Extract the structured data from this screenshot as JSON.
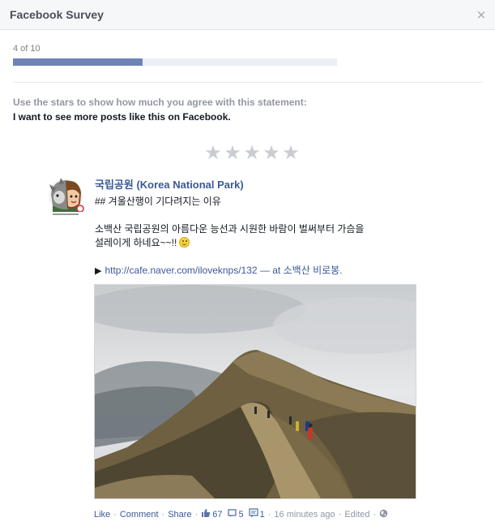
{
  "dialog": {
    "title": "Facebook Survey",
    "close_glyph": "×"
  },
  "progress": {
    "text": "4 of 10",
    "current": 4,
    "total": 10,
    "fraction": 0.4,
    "fill_color": "#6d84b4"
  },
  "question": {
    "instruction": "Use the stars to show how much you agree with this statement:",
    "statement": "I want to see more posts like this on Facebook.",
    "stars_total": 5,
    "stars_selected": 0,
    "star_glyph": "★"
  },
  "post": {
    "page_name": "국립공원 (Korea National Park)",
    "line1": "## 겨울산행이 기다려지는 이유",
    "line2": "소백산 국립공원의 아름다운 능선과 시원한 바람이 벌써부터 가슴을",
    "line3": "설레이게 하네요~~!!",
    "arrow": "▶",
    "link_url": "http://cafe.naver.com/iloveknps/132",
    "link_sep": "— at",
    "place": "소백산 비로봉",
    "place_end": ".",
    "avatar_icon": "korea-national-park-mascot",
    "photo": "mountain-ridge-hikers"
  },
  "footer": {
    "like": "Like",
    "comment": "Comment",
    "share": "Share",
    "likes_count": "67",
    "shares_count": "5",
    "comments_count": "1",
    "time": "16 minutes ago",
    "edited": "Edited",
    "dot": "·"
  }
}
